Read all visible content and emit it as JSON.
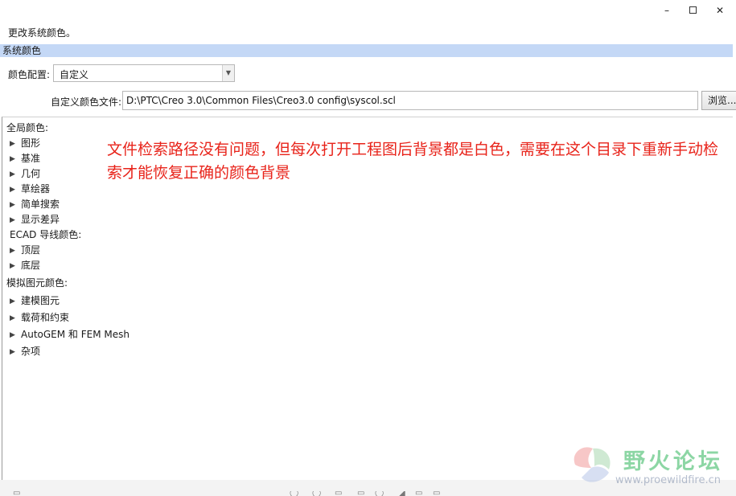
{
  "window": {
    "minimize_glyph": "–",
    "close_glyph": "✕"
  },
  "description": "更改系统颜色。",
  "section": {
    "title": "系统颜色"
  },
  "color_scheme": {
    "label": "颜色配置:",
    "value": "自定义"
  },
  "custom_file": {
    "label": "自定义颜色文件:",
    "value": "D:\\PTC\\Creo 3.0\\Common Files\\Creo3.0 config\\syscol.scl",
    "browse_label": "浏览..."
  },
  "tree": {
    "global_label": "全局颜色:",
    "global_items": [
      "图形",
      "基准",
      "几何",
      "草绘器",
      "简单搜索",
      "显示差异"
    ],
    "ecad_label": "ECAD 导线颜色:",
    "ecad_items": [
      "顶层",
      "底层"
    ],
    "sim_label": "模拟图元颜色:",
    "sim_items": [
      "建模图元",
      "载荷和约束",
      "AutoGEM 和 FEM Mesh",
      "杂项"
    ]
  },
  "annotation": "文件检索路径没有问题，但每次打开工程图后背景都是白色，需要在这个目录下重新手动检索才能恢复正确的颜色背景",
  "watermark": {
    "title": "野火论坛",
    "url": "www.proewildfire.cn"
  },
  "colors": {
    "section_bar": "#c4d8f6",
    "annotation": "#e8231a",
    "watermark": "#2fb55a"
  }
}
